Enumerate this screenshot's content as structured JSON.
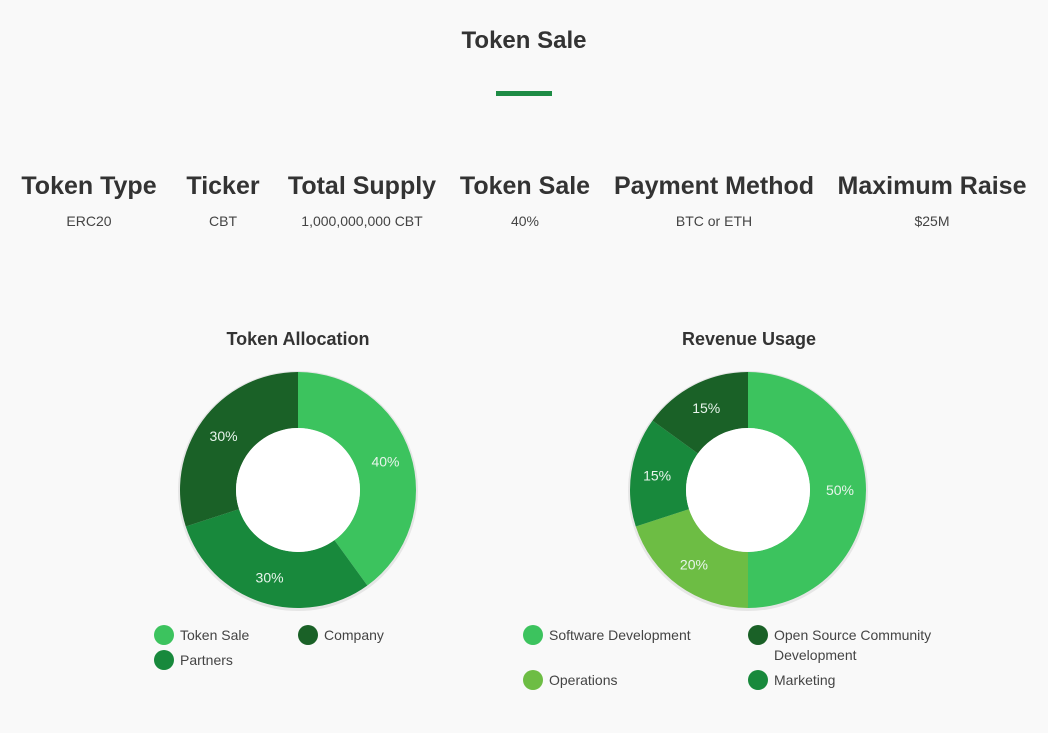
{
  "header": {
    "title": "Token Sale"
  },
  "stats": [
    {
      "label": "Token Type",
      "value": "ERC20"
    },
    {
      "label": "Ticker",
      "value": "CBT"
    },
    {
      "label": "Total Supply",
      "value": "1,000,000,000 CBT"
    },
    {
      "label": "Token Sale",
      "value": "40%"
    },
    {
      "label": "Payment Method",
      "value": "BTC or ETH"
    },
    {
      "label": "Maximum Raise",
      "value": "$25M"
    }
  ],
  "colors": {
    "accent": "#1e8c45",
    "green_light": "#3cc35e",
    "green_mid": "#18893c",
    "green_dark": "#1a6127",
    "green_lime": "#6dbd44"
  },
  "chart_data": [
    {
      "type": "pie",
      "title": "Token Allocation",
      "categories": [
        "Token Sale",
        "Partners",
        "Company"
      ],
      "values": [
        40,
        30,
        30
      ],
      "labels": [
        "40%",
        "30%",
        "30%"
      ],
      "colors": [
        "#3cc35e",
        "#18893c",
        "#1a6127"
      ],
      "legend": [
        {
          "label": "Token Sale",
          "color": "#3cc35e"
        },
        {
          "label": "Company",
          "color": "#1a6127"
        },
        {
          "label": "Partners",
          "color": "#18893c"
        }
      ]
    },
    {
      "type": "pie",
      "title": "Revenue Usage",
      "categories": [
        "Software Development",
        "Operations",
        "Marketing",
        "Open Source Community Development"
      ],
      "values": [
        50,
        20,
        15,
        15
      ],
      "labels": [
        "50%",
        "20%",
        "15%",
        "15%"
      ],
      "colors": [
        "#3cc35e",
        "#6dbd44",
        "#18893c",
        "#1a6127"
      ],
      "legend": [
        {
          "label": "Software Development",
          "color": "#3cc35e"
        },
        {
          "label": "Open Source Community Development",
          "color": "#1a6127"
        },
        {
          "label": "Operations",
          "color": "#6dbd44"
        },
        {
          "label": "Marketing",
          "color": "#18893c"
        }
      ]
    }
  ]
}
